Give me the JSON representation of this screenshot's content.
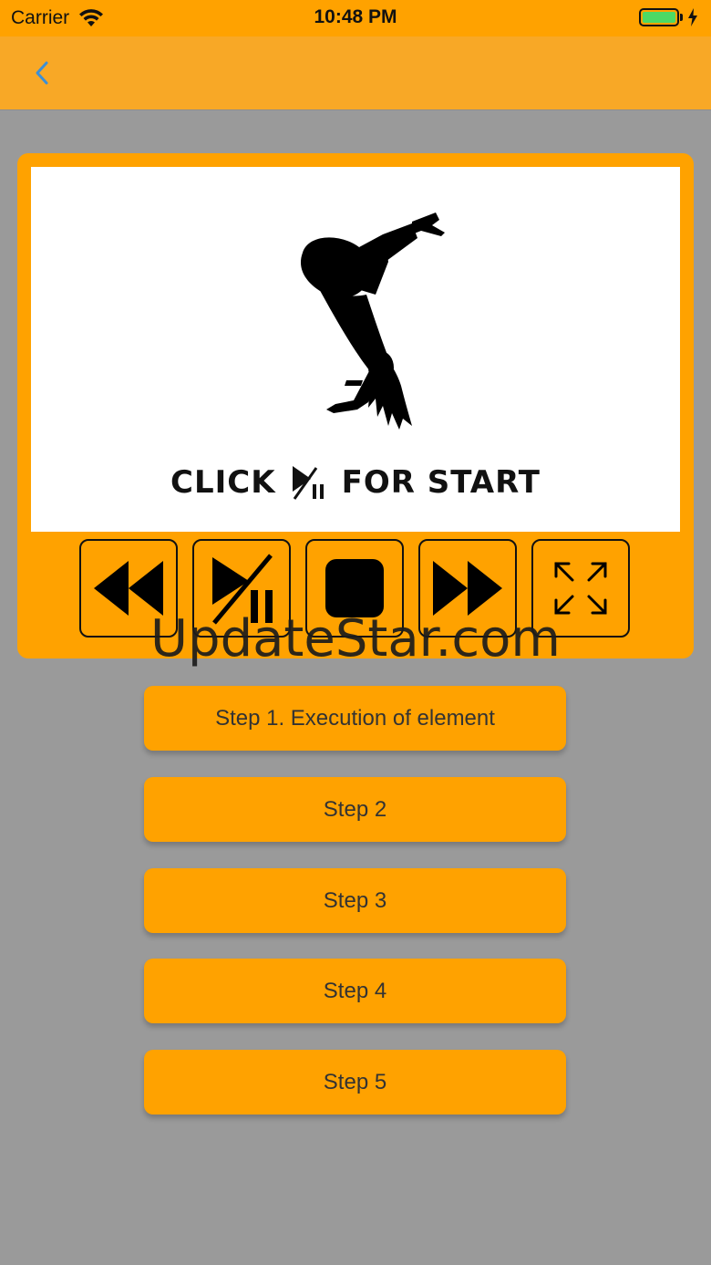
{
  "status_bar": {
    "carrier": "Carrier",
    "time": "10:48 PM",
    "battery_color": "#4cd964"
  },
  "nav": {
    "back_icon": "chevron-left-icon"
  },
  "player": {
    "start_text_left": "CLICK",
    "start_text_right": "FOR START",
    "controls": [
      {
        "name": "rewind-button",
        "icon": "rewind-icon"
      },
      {
        "name": "play-pause-button",
        "icon": "play-pause-icon"
      },
      {
        "name": "stop-button",
        "icon": "stop-icon"
      },
      {
        "name": "fast-forward-button",
        "icon": "fast-forward-icon"
      },
      {
        "name": "fullscreen-button",
        "icon": "expand-icon"
      }
    ]
  },
  "watermark": "UpdateStar.com",
  "steps": [
    {
      "label": "Step 1. Execution of element"
    },
    {
      "label": "Step 2"
    },
    {
      "label": "Step 3"
    },
    {
      "label": "Step 4"
    },
    {
      "label": "Step 5"
    }
  ],
  "colors": {
    "accent": "#ffa200",
    "nav_bar": "#f8a826",
    "background": "#9a9a9a",
    "back_chevron": "#3d8fd6"
  }
}
